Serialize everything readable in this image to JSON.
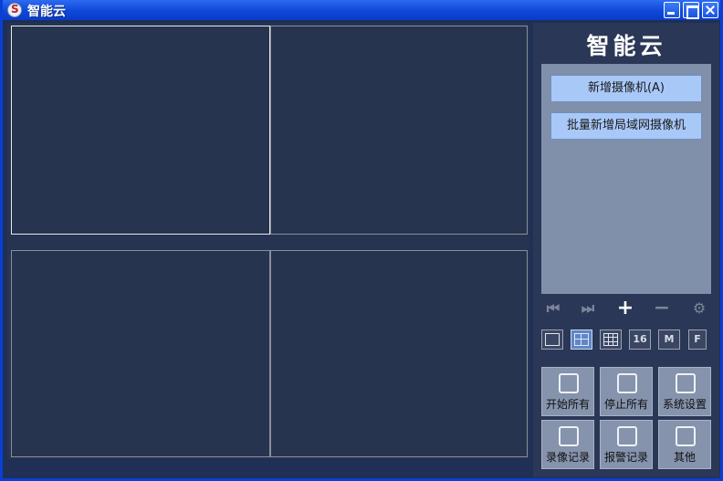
{
  "window": {
    "title": "智能云",
    "title_bar_color": "#0e47d8"
  },
  "video_grid": {
    "layout": "2x2",
    "selected_cell": 1,
    "cells": [
      {
        "id": 1
      },
      {
        "id": 2
      },
      {
        "id": 3
      },
      {
        "id": 4
      }
    ]
  },
  "panel": {
    "brand": "智能云",
    "camera_list": {
      "add_camera": "新增摄像机(A)",
      "batch_add_lan": "批量新增局域网摄像机"
    },
    "controls": {
      "first": "⏮",
      "last": "⏭",
      "plus": "+",
      "minus": "−",
      "gear": "⚙"
    },
    "layouts": [
      {
        "label": "",
        "icon": "single-view-icon"
      },
      {
        "label": "",
        "icon": "four-view-icon",
        "active": true
      },
      {
        "label": "",
        "icon": "nine-view-icon"
      },
      {
        "label": "16",
        "icon": "sixteen-view-icon"
      },
      {
        "label": "M",
        "icon": "multi-view-icon"
      },
      {
        "label": "F",
        "icon": "fullscreen-icon"
      }
    ],
    "actions": [
      {
        "label": "开始所有",
        "icon": "start-all-icon"
      },
      {
        "label": "停止所有",
        "icon": "stop-all-icon"
      },
      {
        "label": "系统设置",
        "icon": "settings-icon"
      },
      {
        "label": "录像记录",
        "icon": "recording-log-icon"
      },
      {
        "label": "报警记录",
        "icon": "alarm-log-icon"
      },
      {
        "label": "其他",
        "icon": "other-tools-icon"
      }
    ]
  }
}
